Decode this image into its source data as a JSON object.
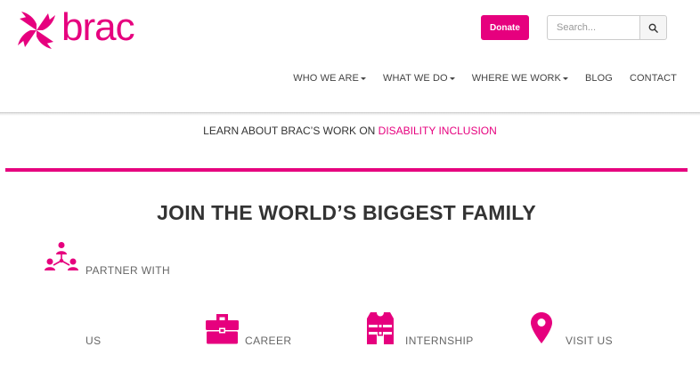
{
  "brand": {
    "name": "brac",
    "accent": "#e6007e"
  },
  "header": {
    "donate_label": "Donate",
    "search_placeholder": "Search...",
    "search_icon": "search-icon"
  },
  "nav": {
    "items": [
      {
        "label": "WHO WE ARE",
        "has_dropdown": true
      },
      {
        "label": "WHAT WE DO",
        "has_dropdown": true
      },
      {
        "label": "WHERE WE WORK",
        "has_dropdown": true
      },
      {
        "label": "BLOG",
        "has_dropdown": false
      },
      {
        "label": "CONTACT",
        "has_dropdown": false
      }
    ]
  },
  "announcement": {
    "prefix": "LEARN ABOUT BRAC’S WORK ON ",
    "link": "DISABILITY INCLUSION"
  },
  "join": {
    "title": "JOIN THE WORLD’S BIGGEST FAMILY",
    "items": [
      {
        "icon": "network-people-icon",
        "label": "PARTNER WITH"
      },
      {
        "icon": "",
        "label": "US"
      },
      {
        "icon": "briefcase-icon",
        "label": "CAREER"
      },
      {
        "icon": "vest-icon",
        "label": "INTERNSHIP"
      },
      {
        "icon": "location-pin-icon",
        "label": "VISIT US"
      }
    ]
  }
}
